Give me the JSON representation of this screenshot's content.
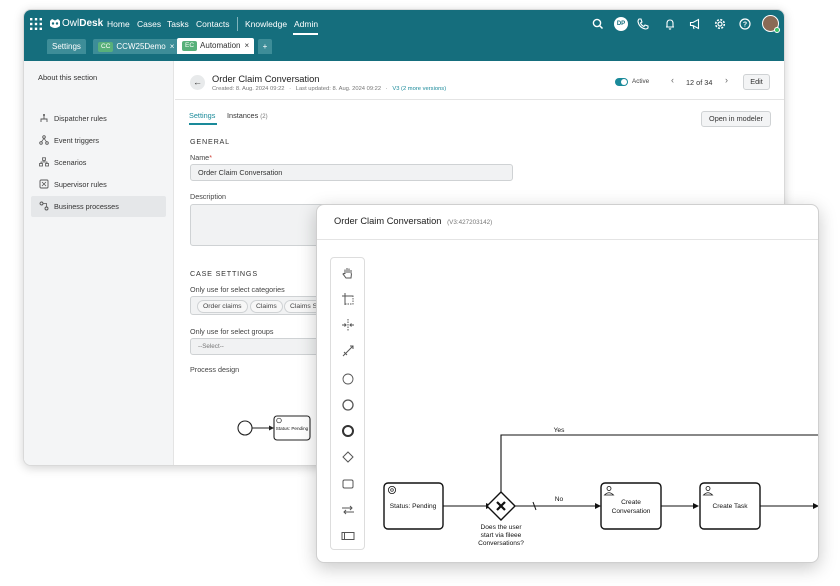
{
  "app": {
    "brand": "OwlDesk"
  },
  "topnav": {
    "items": [
      "Home",
      "Cases",
      "Tasks",
      "Contacts",
      "Knowledge",
      "Admin"
    ],
    "active": "Admin",
    "avatar_initials": "DP"
  },
  "tabs": [
    {
      "label": "Settings"
    },
    {
      "badge": "CC",
      "label": "CCW25Demo"
    },
    {
      "badge": "EC",
      "label": "Automation"
    }
  ],
  "sidebar": {
    "title": "About this section",
    "items": [
      {
        "label": "Dispatcher rules",
        "icon": "dispatcher-icon"
      },
      {
        "label": "Event triggers",
        "icon": "event-trigger-icon"
      },
      {
        "label": "Scenarios",
        "icon": "scenarios-icon"
      },
      {
        "label": "Supervisor rules",
        "icon": "supervisor-icon"
      },
      {
        "label": "Business processes",
        "icon": "business-process-icon"
      }
    ]
  },
  "record": {
    "title": "Order Claim Conversation",
    "created": "Created: 8. Aug. 2024 09:22",
    "updated": "Last updated: 8. Aug. 2024 09:22",
    "version": "V3 (2 more versions)",
    "status_label": "Active",
    "pager": "12 of 34",
    "edit_label": "Edit"
  },
  "subtabs": {
    "settings": "Settings",
    "instances": "Instances",
    "instances_count": "(2)"
  },
  "open_modeler_label": "Open in modeler",
  "general": {
    "header": "GENERAL",
    "name_label": "Name",
    "name_value": "Order Claim Conversation",
    "description_label": "Description"
  },
  "case_settings": {
    "header": "CASE SETTINGS",
    "categories_label": "Only use for select categories",
    "categories": [
      "Order claims",
      "Claims",
      "Claims Se"
    ],
    "groups_label": "Only use for select groups",
    "groups_placeholder": "--Select--",
    "process_design_label": "Process design",
    "mini_node_label": "Status: Pending"
  },
  "modeler": {
    "title": "Order Claim Conversation",
    "version": "(V3:427203142)",
    "palette": [
      "hand-tool-icon",
      "lasso-tool-icon",
      "space-tool-icon",
      "connect-tool-icon",
      "start-event-icon",
      "intermediate-event-icon",
      "end-event-icon",
      "gateway-icon",
      "task-icon",
      "subprocess-icon",
      "pool-icon"
    ],
    "nodes": {
      "status": "Status: Pending",
      "gateway_question": [
        "Does the user",
        "start via fileee",
        "Conversations?"
      ],
      "create_conversation": [
        "Create",
        "Conversation"
      ],
      "create_task": "Create Task"
    },
    "edges": {
      "yes": "Yes",
      "no": "No"
    }
  },
  "colors": {
    "header": "#156e7d",
    "accent": "#1a8a9a",
    "active_toggle": "#1a8a9a"
  }
}
